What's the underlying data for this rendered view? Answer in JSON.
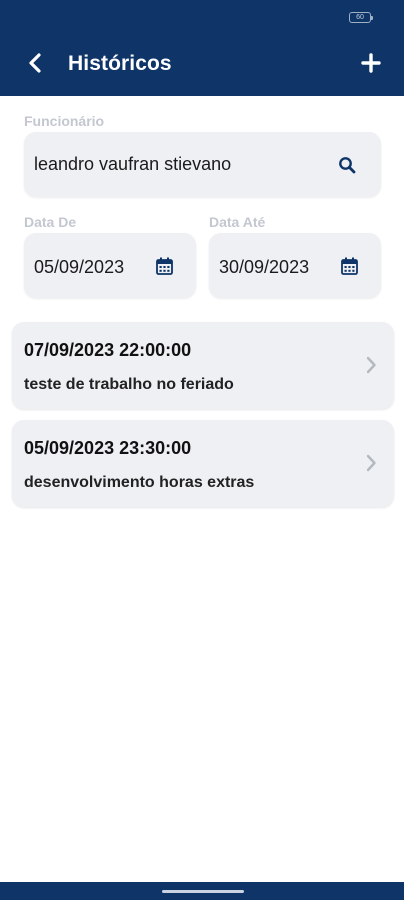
{
  "status_bar": {
    "battery_level": "60"
  },
  "header": {
    "title": "Históricos",
    "back_icon": "chevron-left-icon",
    "add_icon": "plus-icon"
  },
  "form": {
    "employee": {
      "label": "Funcionário",
      "value": "leandro vaufran stievano",
      "icon": "search-icon"
    },
    "date_from": {
      "label": "Data De",
      "value": "05/09/2023",
      "icon": "calendar-icon"
    },
    "date_to": {
      "label": "Data Até",
      "value": "30/09/2023",
      "icon": "calendar-icon"
    }
  },
  "records": [
    {
      "datetime": "07/09/2023 22:00:00",
      "description": "teste de trabalho no feriado"
    },
    {
      "datetime": "05/09/2023 23:30:00",
      "description": "desenvolvimento horas extras"
    }
  ],
  "colors": {
    "header_bg": "#0e3468",
    "accent": "#0e3468",
    "input_bg": "#eef0f4",
    "label_gray": "#c3c7cf"
  }
}
